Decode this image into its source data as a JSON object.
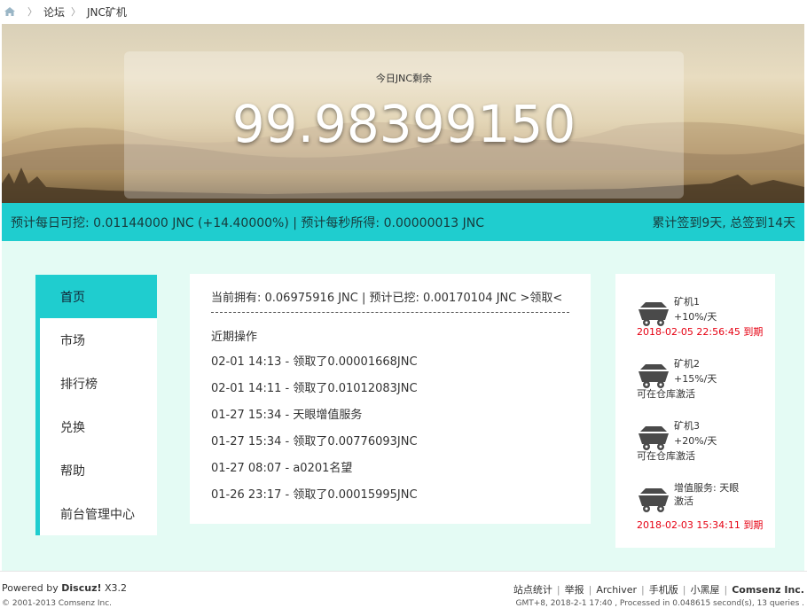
{
  "breadcrumb": {
    "items": [
      "论坛",
      "JNC矿机"
    ]
  },
  "hero": {
    "label": "今日JNC剩余",
    "remaining": "99.98399150"
  },
  "stats_bar": {
    "left": "预计每日可挖: 0.01144000 JNC (+14.40000%) | 预计每秒所得: 0.00000013 JNC",
    "right": "累计签到9天, 总签到14天"
  },
  "nav": {
    "items": [
      "首页",
      "市场",
      "排行榜",
      "兑换",
      "帮助",
      "前台管理中心"
    ],
    "active_index": 0
  },
  "center": {
    "owned_text": "当前拥有: 0.06975916 JNC | 预计已挖: 0.00170104 JNC ",
    "claim_link": ">领取<",
    "recent_title": "近期操作",
    "logs": [
      "02-01 14:13 - 领取了0.00001668JNC",
      "02-01 14:11 - 领取了0.01012083JNC",
      "01-27 15:34 - 天眼增值服务",
      "01-27 15:34 - 领取了0.00776093JNC",
      "01-27 08:07 - a0201名望",
      "01-26 23:17 - 领取了0.00015995JNC"
    ]
  },
  "machines": [
    {
      "name": "矿机1",
      "rate": "+10%/天",
      "status": "2018-02-05 22:56:45 到期",
      "status_color": "#e60012"
    },
    {
      "name": "矿机2",
      "rate": "+15%/天",
      "status": "可在仓库激活",
      "status_color": "#333333"
    },
    {
      "name": "矿机3",
      "rate": "+20%/天",
      "status": "可在仓库激活",
      "status_color": "#333333"
    },
    {
      "name": "增值服务: 天眼激活",
      "rate": "",
      "status": "2018-02-03 15:34:11 到期",
      "status_color": "#e60012"
    }
  ],
  "footer": {
    "powered_prefix": "Powered by ",
    "powered_brand": "Discuz!",
    "powered_version": " X3.2",
    "copyright": "© 2001-2013 Comsenz Inc.",
    "links": [
      "站点统计",
      "举报",
      "Archiver",
      "手机版",
      "小黑屋",
      "Comsenz Inc."
    ],
    "gmt": "GMT+8, 2018-2-1 17:40 , Processed in 0.048615 second(s), 13 queries ."
  },
  "colors": {
    "accent": "#1fcdcf",
    "main_bg": "#e4fbf4",
    "expire": "#e60012"
  },
  "icons": {
    "home": "home-icon",
    "mine_cart": "mine-cart-icon"
  }
}
